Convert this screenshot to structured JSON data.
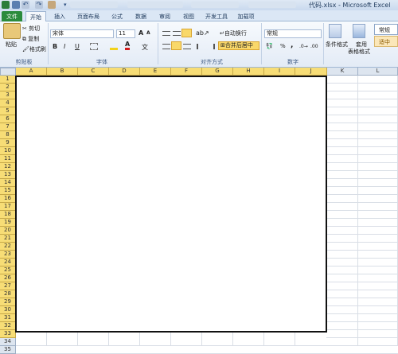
{
  "titlebar": {
    "title": "代码.xlsx - Microsoft Excel"
  },
  "tabs": [
    {
      "label": "文件"
    },
    {
      "label": "开始"
    },
    {
      "label": "插入"
    },
    {
      "label": "页面布局"
    },
    {
      "label": "公式"
    },
    {
      "label": "数据"
    },
    {
      "label": "审阅"
    },
    {
      "label": "视图"
    },
    {
      "label": "开发工具"
    },
    {
      "label": "加载项"
    }
  ],
  "ribbon": {
    "clipboard": {
      "paste": "粘贴",
      "cut": "剪切",
      "copy": "复制",
      "format_painter": "格式刷",
      "group": "剪贴板"
    },
    "font": {
      "name": "宋体",
      "size": "11",
      "bold": "B",
      "italic": "I",
      "underline": "U",
      "grow": "A",
      "shrink": "A",
      "wen": "文",
      "font_color_a": "A",
      "group": "字体"
    },
    "alignment": {
      "wrap": "自动换行",
      "merge": "合并后居中",
      "group": "对齐方式"
    },
    "number": {
      "format": "常规",
      "percent": "%",
      "comma": ",",
      "group": "数字"
    },
    "styles": {
      "conditional": "条件格式",
      "table_format_1": "套用",
      "table_format_2": "表格格式",
      "normal": "常规",
      "good": "适中"
    }
  },
  "sheet": {
    "columns": [
      "A",
      "B",
      "C",
      "D",
      "E",
      "F",
      "G",
      "H",
      "I",
      "J",
      "K",
      "L"
    ],
    "rows": [
      "1",
      "2",
      "3",
      "4",
      "5",
      "6",
      "7",
      "8",
      "9",
      "10",
      "11",
      "12",
      "13",
      "14",
      "15",
      "16",
      "17",
      "18",
      "19",
      "20",
      "21",
      "22",
      "23",
      "24",
      "25",
      "26",
      "27",
      "28",
      "29",
      "30",
      "31",
      "32",
      "33",
      "34",
      "35"
    ]
  },
  "colors": {
    "file_tab": "#2a8b3c",
    "header_highlight": "#f7dd76",
    "selection_border": "#111111"
  }
}
